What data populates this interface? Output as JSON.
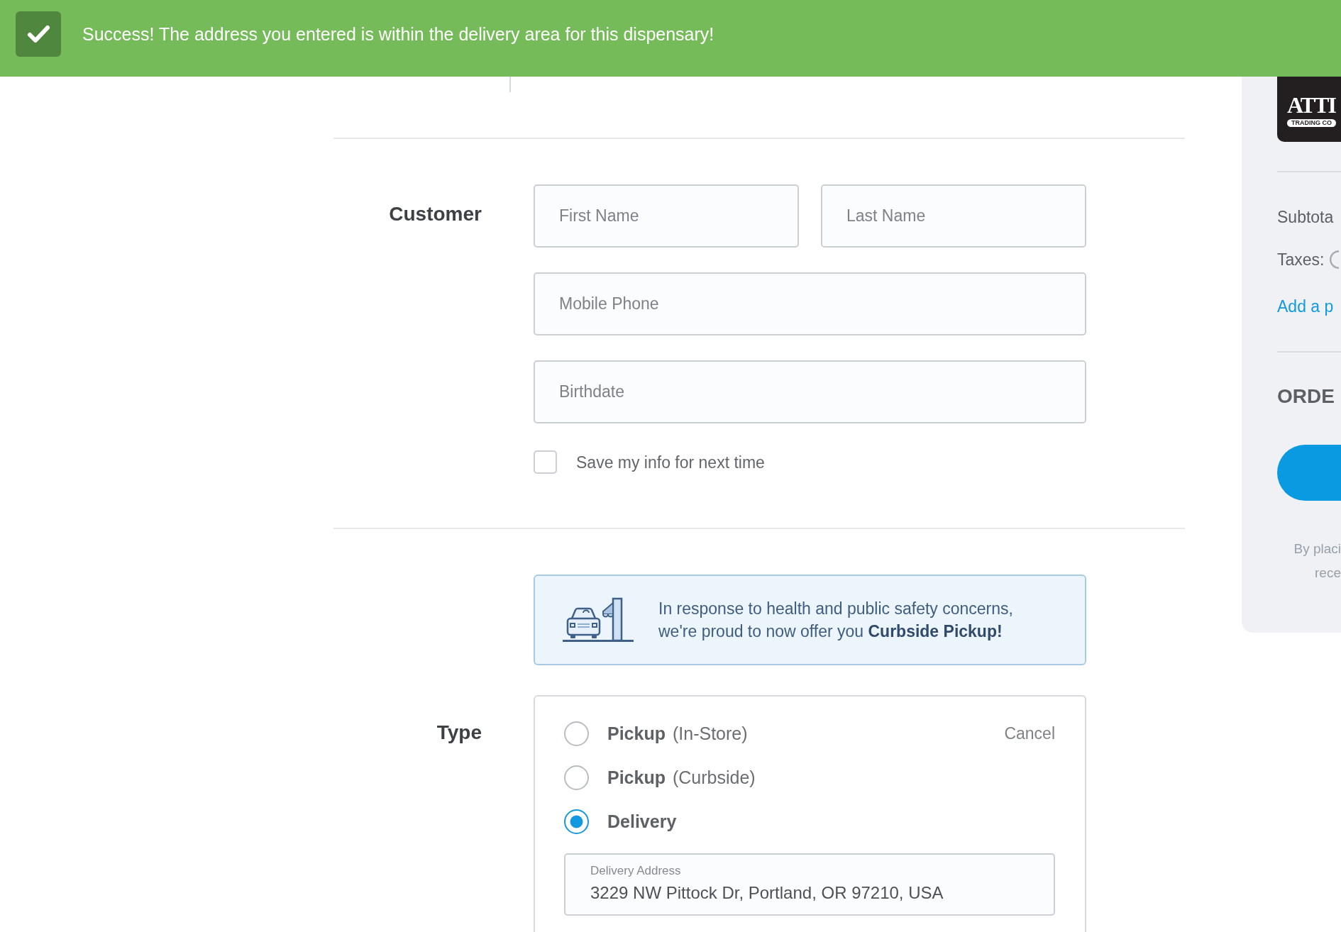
{
  "toast": {
    "kind": "success",
    "message": "Success! The address you entered is within the delivery area for this dispensary!"
  },
  "customer": {
    "heading": "Customer",
    "first_name": {
      "placeholder": "First Name"
    },
    "last_name": {
      "placeholder": "Last Name"
    },
    "mobile_phone": {
      "placeholder": "Mobile Phone"
    },
    "birthdate": {
      "placeholder": "Birthdate"
    },
    "save_info": {
      "label": "Save my info for next time",
      "checked": false
    }
  },
  "curbside_notice": {
    "text": "In response to health and public safety concerns, we're proud to now offer you **Curbside Pickup!**"
  },
  "order_type": {
    "heading": "Type",
    "cancel": "Cancel",
    "options": [
      {
        "label": "Pickup",
        "detail": "(In-Store)",
        "selected": false
      },
      {
        "label": "Pickup",
        "detail": "(Curbside)",
        "selected": false
      },
      {
        "label": "Delivery",
        "selected": true
      }
    ],
    "delivery_address": {
      "label": "Delivery Address",
      "value": "3229 NW Pittock Dr, Portland, OR 97210, USA"
    }
  },
  "summary": {
    "logo": {
      "wordmark": "ATTI",
      "tagline": "TRADING CO"
    },
    "subtotal_label": "Subtota",
    "taxes_label": "Taxes:",
    "promo_link": "Add a p",
    "section_heading": "ORDE",
    "note_lines": [
      "By placi",
      "rece"
    ]
  }
}
